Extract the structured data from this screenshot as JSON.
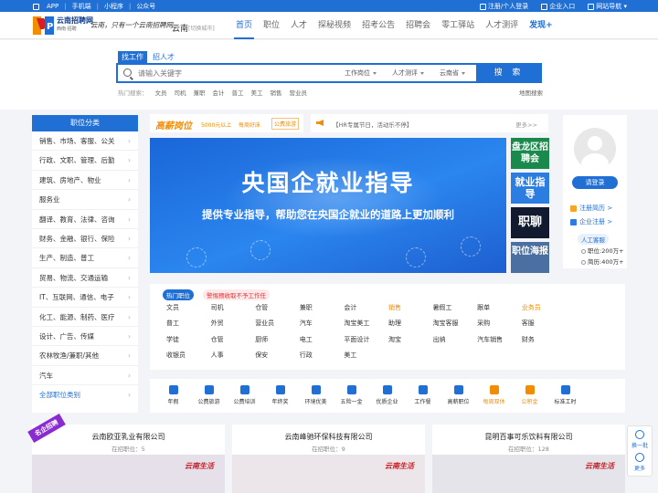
{
  "topbar": {
    "left": [
      "APP",
      "手机端",
      "小程序",
      "公众号"
    ],
    "right": [
      "注册/个人登录",
      "企业入口",
      "网站导航"
    ]
  },
  "header": {
    "logo_text": "云南招聘网",
    "logo_sub": "西南·招聘",
    "slogan": "云南，只有一个云南招聘网",
    "city": "云南",
    "city_switch": "[切换城市]",
    "nav": [
      "首页",
      "职位",
      "人才",
      "探秘视频",
      "招考公告",
      "招聘会",
      "零工驿站",
      "人才测评",
      "发现+"
    ]
  },
  "search": {
    "tabs": [
      "找工作",
      "招人才"
    ],
    "placeholder": "请输入关键字",
    "selects": [
      "工作岗位",
      "人才测评",
      "云南省"
    ],
    "button": "搜 索",
    "hot_label": "热门搜索：",
    "hot": [
      "文员",
      "司机",
      "兼职",
      "会计",
      "普工",
      "美工",
      "销售",
      "营业员"
    ],
    "map": "地图搜索"
  },
  "categories": {
    "title": "职位分类",
    "items": [
      "销售、市场、客服、公关",
      "行政、文职、管理、后勤",
      "建筑、房地产、物业",
      "服务业",
      "翻译、教育、法律、咨询",
      "财务、金融、银行、保险",
      "生产、制造、普工",
      "贸易、物流、交通运输",
      "IT、互联网、通信、电子",
      "化工、能源、制药、医疗",
      "设计、广告、传媒",
      "农林牧渔/兼职/其他",
      "汽车"
    ],
    "all": "全部职位类别"
  },
  "strip": {
    "brand": "高薪岗位",
    "t1": "5000元以上",
    "t2": "每周好床",
    "t3": "公费旅游"
  },
  "notice": {
    "text": "【HR专属节日，活动乐不停】",
    "more": "更多>>"
  },
  "banner": {
    "title": "央国企就业指导",
    "subtitle": "提供专业指导，帮助您在央国企就业的道路上更加顺利"
  },
  "side_tiles": [
    "盘龙区招聘会",
    "就业指导",
    "职聊",
    "职位海报"
  ],
  "user": {
    "login": "请登录",
    "register": "注册简历 >",
    "company_register": "企业注册 >",
    "service": "人工客服",
    "jobs": "职位:200万+",
    "resumes": "简历:400万+"
  },
  "hot_jobs": {
    "tag": "热门职位",
    "warning": "警惕预收取不予工作任",
    "items": [
      "文员",
      "司机",
      "仓管",
      "兼职",
      "会计",
      "销售",
      "暑假工",
      "跟单",
      "业务员",
      "普工",
      "外贸",
      "营业员",
      "汽车",
      "淘宝美工",
      "助理",
      "淘宝客服",
      "采购",
      "客服",
      "学徒",
      "仓管",
      "厨师",
      "电工",
      "平面设计",
      "淘宝",
      "出纳",
      "汽车销售",
      "财务",
      "收银员",
      "人事",
      "保安",
      "行政",
      "美工"
    ],
    "highlight": [
      "销售",
      "业务员"
    ]
  },
  "benefits": {
    "items": [
      "年假",
      "公费旅游",
      "公费培训",
      "年终奖",
      "环境优美",
      "五险一金",
      "优质企业",
      "工作餐",
      "高薪职位",
      "每周双休",
      "公积金",
      "标准工时"
    ],
    "highlight": [
      "每周双休",
      "公积金"
    ]
  },
  "companies": [
    {
      "name": "云南欧亚乳业有限公司",
      "count": "在招职位：5"
    },
    {
      "name": "云南峰驰环保科技有限公司",
      "count": "在招职位：9"
    },
    {
      "name": "昆明百事可乐饮料有限公司",
      "count": "在招职位：128"
    }
  ],
  "ribbon": "名企招聘",
  "company_logo": "云南生活",
  "float": [
    "换一批",
    "更多"
  ]
}
